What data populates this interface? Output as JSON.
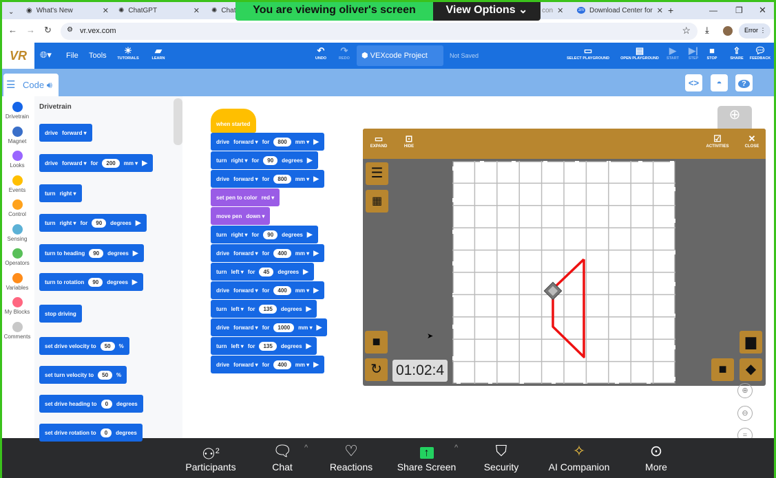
{
  "browser": {
    "tabs": [
      {
        "label": "What's New"
      },
      {
        "label": "ChatGPT"
      },
      {
        "label": "Chat"
      },
      {
        "label": "con"
      },
      {
        "label": "Download Center for"
      }
    ],
    "url": "vr.vex.com",
    "profile_label": "Error"
  },
  "zoom_share": {
    "banner": "You are viewing  oliver's screen",
    "view_options": "View Options"
  },
  "toolbar": {
    "logo": "VR",
    "file": "File",
    "tools": "Tools",
    "tutorials": "TUTORIALS",
    "learn": "LEARN",
    "undo": "UNDO",
    "redo": "REDO",
    "project": "VEXcode Project",
    "save_status": "Not Saved",
    "select_playground": "SELECT PLAYGROUND",
    "open_playground": "OPEN PLAYGROUND",
    "start": "START",
    "step": "STEP",
    "stop": "STOP",
    "share": "SHARE",
    "feedback": "FEEDBACK"
  },
  "code_tab": "Code",
  "categories": [
    {
      "label": "Drivetrain",
      "color": "#1565e8"
    },
    {
      "label": "Magnet",
      "color": "#3a6fc9"
    },
    {
      "label": "Looks",
      "color": "#9966ff"
    },
    {
      "label": "Events",
      "color": "#ffbf00"
    },
    {
      "label": "Control",
      "color": "#ffa21c"
    },
    {
      "label": "Sensing",
      "color": "#5cb1d6"
    },
    {
      "label": "Operators",
      "color": "#59c059"
    },
    {
      "label": "Variables",
      "color": "#ff8c1a"
    },
    {
      "label": "My Blocks",
      "color": "#ff6680"
    },
    {
      "label": "Comments",
      "color": "#c8c8c8"
    }
  ],
  "palette": {
    "title": "Drivetrain",
    "blocks": [
      [
        {
          "t": "drive"
        },
        {
          "t": "forward",
          "d": 1
        }
      ],
      [
        {
          "t": "drive"
        },
        {
          "t": "forward",
          "d": 1
        },
        {
          "t": "for"
        },
        {
          "n": "200"
        },
        {
          "t": "mm",
          "d": 1
        },
        {
          "a": 1
        }
      ],
      [
        {
          "t": "turn"
        },
        {
          "t": "right",
          "d": 1
        }
      ],
      [
        {
          "t": "turn"
        },
        {
          "t": "right",
          "d": 1
        },
        {
          "t": "for"
        },
        {
          "n": "90"
        },
        {
          "t": "degrees"
        },
        {
          "a": 1
        }
      ],
      [
        {
          "t": "turn to heading"
        },
        {
          "n": "90"
        },
        {
          "t": "degrees"
        },
        {
          "a": 1
        }
      ],
      [
        {
          "t": "turn to rotation"
        },
        {
          "n": "90"
        },
        {
          "t": "degrees"
        },
        {
          "a": 1
        }
      ],
      [
        {
          "t": "stop driving"
        }
      ],
      [
        {
          "t": "set drive velocity to"
        },
        {
          "n": "50"
        },
        {
          "t": "%"
        }
      ],
      [
        {
          "t": "set turn velocity to"
        },
        {
          "n": "50"
        },
        {
          "t": "%"
        }
      ],
      [
        {
          "t": "set drive heading to"
        },
        {
          "n": "0"
        },
        {
          "t": "degrees"
        }
      ],
      [
        {
          "t": "set drive rotation to"
        },
        {
          "n": "0"
        },
        {
          "t": "degrees"
        }
      ]
    ]
  },
  "script": {
    "hat": "when started",
    "blocks": [
      {
        "c": "blue",
        "p": [
          {
            "t": "drive"
          },
          {
            "t": "forward",
            "d": 1
          },
          {
            "t": "for"
          },
          {
            "n": "800"
          },
          {
            "t": "mm",
            "d": 1
          },
          {
            "a": 1
          }
        ]
      },
      {
        "c": "blue",
        "p": [
          {
            "t": "turn"
          },
          {
            "t": "right",
            "d": 1
          },
          {
            "t": "for"
          },
          {
            "n": "90"
          },
          {
            "t": "degrees"
          },
          {
            "a": 1
          }
        ]
      },
      {
        "c": "blue",
        "p": [
          {
            "t": "drive"
          },
          {
            "t": "forward",
            "d": 1
          },
          {
            "t": "for"
          },
          {
            "n": "800"
          },
          {
            "t": "mm",
            "d": 1
          },
          {
            "a": 1
          }
        ]
      },
      {
        "c": "purple",
        "p": [
          {
            "t": "set pen to color"
          },
          {
            "t": "red",
            "d": 1
          }
        ]
      },
      {
        "c": "purple",
        "p": [
          {
            "t": "move pen"
          },
          {
            "t": "down",
            "d": 1
          }
        ]
      },
      {
        "c": "blue",
        "p": [
          {
            "t": "turn"
          },
          {
            "t": "right",
            "d": 1
          },
          {
            "t": "for"
          },
          {
            "n": "90"
          },
          {
            "t": "degrees"
          },
          {
            "a": 1
          }
        ]
      },
      {
        "c": "blue",
        "p": [
          {
            "t": "drive"
          },
          {
            "t": "forward",
            "d": 1
          },
          {
            "t": "for"
          },
          {
            "n": "400"
          },
          {
            "t": "mm",
            "d": 1
          },
          {
            "a": 1
          }
        ]
      },
      {
        "c": "blue",
        "p": [
          {
            "t": "turn"
          },
          {
            "t": "left",
            "d": 1
          },
          {
            "t": "for"
          },
          {
            "n": "45"
          },
          {
            "t": "degrees"
          },
          {
            "a": 1
          }
        ]
      },
      {
        "c": "blue",
        "p": [
          {
            "t": "drive"
          },
          {
            "t": "forward",
            "d": 1
          },
          {
            "t": "for"
          },
          {
            "n": "400"
          },
          {
            "t": "mm",
            "d": 1
          },
          {
            "a": 1
          }
        ]
      },
      {
        "c": "blue",
        "p": [
          {
            "t": "turn"
          },
          {
            "t": "left",
            "d": 1
          },
          {
            "t": "for"
          },
          {
            "n": "135"
          },
          {
            "t": "degrees"
          },
          {
            "a": 1
          }
        ]
      },
      {
        "c": "blue",
        "p": [
          {
            "t": "drive"
          },
          {
            "t": "forward",
            "d": 1
          },
          {
            "t": "for"
          },
          {
            "n": "1000"
          },
          {
            "t": "mm",
            "d": 1
          },
          {
            "a": 1
          }
        ]
      },
      {
        "c": "blue",
        "p": [
          {
            "t": "turn"
          },
          {
            "t": "left",
            "d": 1
          },
          {
            "t": "for"
          },
          {
            "n": "135"
          },
          {
            "t": "degrees"
          },
          {
            "a": 1
          }
        ]
      },
      {
        "c": "blue",
        "p": [
          {
            "t": "drive"
          },
          {
            "t": "forward",
            "d": 1
          },
          {
            "t": "for"
          },
          {
            "n": "400"
          },
          {
            "t": "mm",
            "d": 1
          },
          {
            "a": 1
          }
        ]
      }
    ]
  },
  "playground": {
    "expand": "EXPAND",
    "hide": "HIDE",
    "activities": "ACTIVITIES",
    "close": "CLOSE",
    "timer": "01:02:4",
    "pen_color": "#ee1111"
  },
  "meeting": {
    "participants": "Participants",
    "participant_count": "2",
    "chat": "Chat",
    "reactions": "Reactions",
    "share_screen": "Share Screen",
    "security": "Security",
    "ai_companion": "AI Companion",
    "more": "More"
  }
}
